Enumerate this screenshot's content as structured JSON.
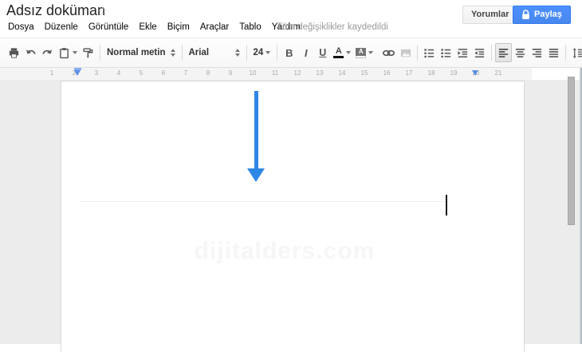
{
  "header": {
    "title": "Adsız doküman",
    "star": "☆",
    "comments_button": "Yorumlar",
    "share_button": "Paylaş",
    "save_status": "Tüm değişiklikler kaydedildi",
    "menus": [
      {
        "label": "Dosya"
      },
      {
        "label": "Düzenle"
      },
      {
        "label": "Görüntüle"
      },
      {
        "label": "Ekle"
      },
      {
        "label": "Biçim"
      },
      {
        "label": "Araçlar"
      },
      {
        "label": "Tablo"
      },
      {
        "label": "Yardım"
      }
    ]
  },
  "toolbar": {
    "style_dropdown": "Normal metin",
    "font_dropdown": "Arial",
    "size_dropdown": "24",
    "bold_label": "B",
    "italic_label": "I",
    "underline_label": "U",
    "text_color_label": "A",
    "highlight_label": "A"
  },
  "ruler": {
    "numbers": [
      "1",
      "2",
      "3",
      "4",
      "5",
      "6",
      "7",
      "8",
      "9",
      "10",
      "11",
      "12",
      "13",
      "14",
      "15",
      "16",
      "17",
      "18",
      "19",
      "20",
      "21"
    ]
  },
  "document": {
    "watermark": "dijitalders.com"
  },
  "colors": {
    "share_button_blue": "#4d90fe",
    "share_button_border": "#3079ed",
    "arrow_blue": "#2e87e4",
    "ruler_marker_blue": "#5a8de5",
    "background_gray": "#ececec"
  }
}
